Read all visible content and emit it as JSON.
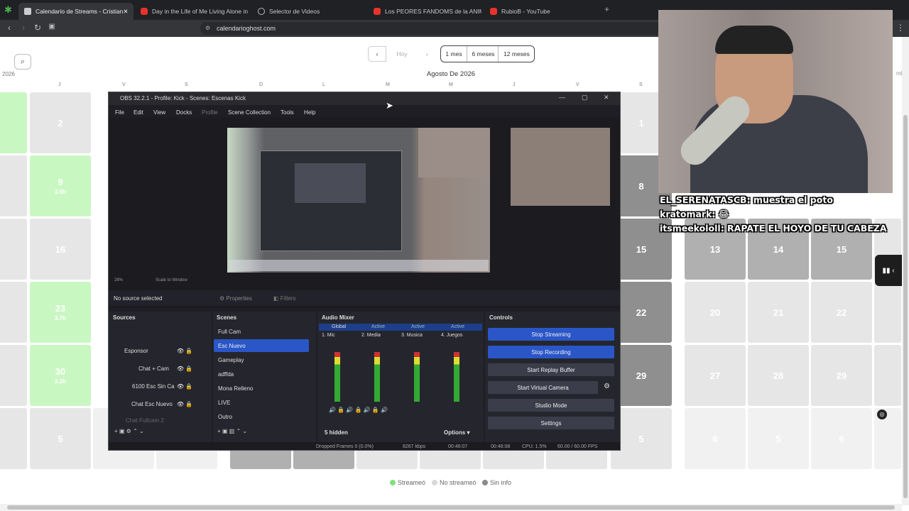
{
  "browser": {
    "tabs": [
      {
        "title": "Calendario de Streams - Cristian",
        "icon": "calendar-icon",
        "active": true
      },
      {
        "title": "Day in the Life of Me Living Alone in",
        "icon": "youtube-icon"
      },
      {
        "title": "Selector de Videos",
        "icon": "globe-icon"
      },
      {
        "title": "Los PEORES FANDOMS de la ANIMA...",
        "icon": "youtube-icon"
      },
      {
        "title": "RubioB - YouTube",
        "icon": "youtube-icon"
      }
    ],
    "new_tab": "+",
    "url": "calendarioghost.com",
    "menu_icon": "⋮"
  },
  "calendar": {
    "nav": {
      "prev": "‹",
      "today": "Hoy",
      "next": "›"
    },
    "ranges": [
      "1 mes",
      "6 meses",
      "12 meses"
    ],
    "month_title": "Agosto De 2026",
    "left_year": "2026",
    "right_fragment": "mb",
    "weekdays_left": [
      "J",
      "V",
      "S",
      "D"
    ],
    "weekdays_right": [
      "L",
      "M",
      "M",
      "J",
      "V",
      "S"
    ],
    "left_cells": [
      "",
      "2",
      "9",
      "16",
      "23",
      "30",
      ""
    ],
    "left_cell_subs": [
      "",
      "",
      "3.5h",
      "",
      "3.7h",
      "3.2h",
      ""
    ],
    "right_col1": [
      "1",
      "8",
      "15",
      "22",
      "29",
      "5"
    ],
    "right_grid": [
      [
        "13",
        "14",
        "15"
      ],
      [
        "20",
        "21",
        "22"
      ],
      [
        "27",
        "28",
        "29"
      ],
      [
        "6",
        "5",
        "6"
      ]
    ],
    "legend": [
      {
        "label": "Streameó",
        "color": "#7fe07a"
      },
      {
        "label": "No streameó",
        "color": "#d9d9d9"
      },
      {
        "label": "Sin info",
        "color": "#8a8a8a"
      }
    ]
  },
  "obs": {
    "title": "OBS 32.2.1 - Profile: Kick - Scenes: Escenas Kick",
    "menu": [
      "File",
      "Edit",
      "View",
      "Docks",
      "Profile",
      "Scene Collection",
      "Tools",
      "Help"
    ],
    "zoom": "28%",
    "scale": "Scale to Window",
    "no_source": "No source selected",
    "properties": "Properties",
    "filters": "Filters",
    "docks": {
      "sources": "Sources",
      "scenes": "Scenes",
      "audio": "Audio Mixer",
      "controls": "Controls"
    },
    "sources": [
      "Esponsor",
      "Chat + Cam",
      "6100 Esc Sin Ca",
      "Chat Esc Nuevo",
      "Chat Fullcam 2"
    ],
    "scenes": [
      "Full Cam",
      "Esc Nuevo",
      "Gameplay",
      "adffda",
      "Mona Relleno",
      "LIVE",
      "Outro"
    ],
    "mixer_tabs": [
      "Global",
      "Active",
      "Active",
      "Active",
      "Active"
    ],
    "channels": [
      "1. Mic",
      "2. Media",
      "3. Musica",
      "4. Juegos"
    ],
    "hidden": "5 hidden",
    "options": "Options",
    "controls": [
      "Stop Streaming",
      "Stop Recording",
      "Start Replay Buffer",
      "Start Virtual Camera",
      "Studio Mode",
      "Settings"
    ],
    "status": {
      "dropped": "Dropped Frames 0 (0.0%)",
      "kbps": "8267 kbps",
      "stream_time": "00:46:07",
      "rec_time": "00:46:08",
      "cpu": "CPU: 1.5%",
      "fps": "60.00 / 60.00 FPS"
    }
  },
  "chat": [
    {
      "user": "EL_SERENATASCB",
      "msg": "muestra el poto"
    },
    {
      "user": "kratomark",
      "msg": "😂"
    },
    {
      "user": "itsmeekololl",
      "msg": "RAPATE EL HOYO DE TU CABEZA"
    }
  ]
}
